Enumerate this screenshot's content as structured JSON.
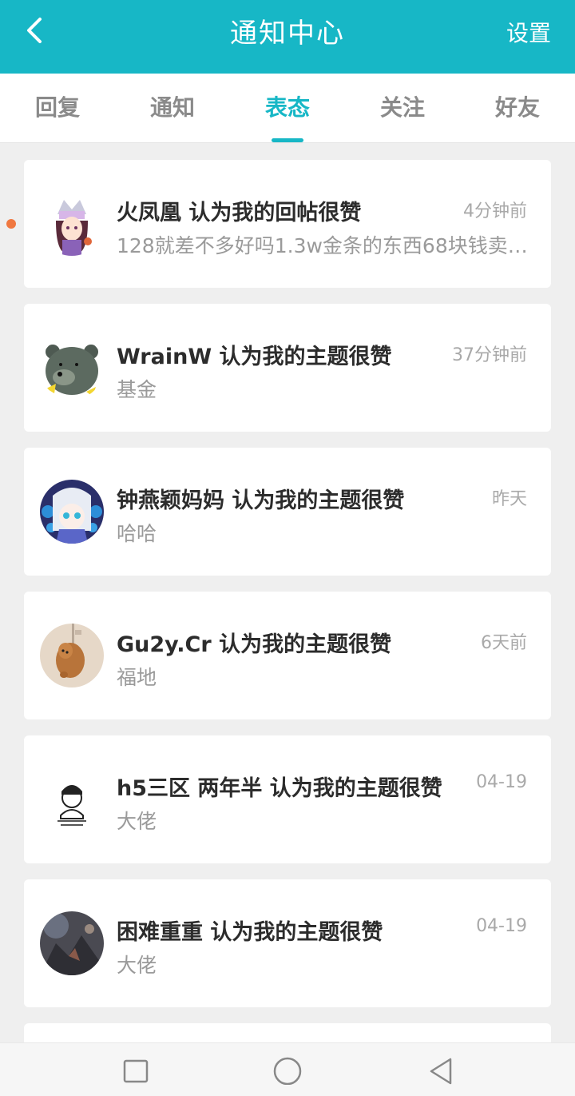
{
  "header": {
    "title": "通知中心",
    "settings_label": "设置",
    "back_icon": "chevron-left-icon",
    "color": "#17b7c6"
  },
  "tabs": [
    {
      "label": "回复",
      "active": false
    },
    {
      "label": "通知",
      "active": false
    },
    {
      "label": "表态",
      "active": true
    },
    {
      "label": "关注",
      "active": false
    },
    {
      "label": "好友",
      "active": false
    }
  ],
  "notifications": [
    {
      "title": "火凤凰 认为我的回帖很赞",
      "time": "4分钟前",
      "content": "128就差不多好吗1.3w金条的东西68块钱卖…",
      "avatar": "anime-girl-avatar",
      "unread": true
    },
    {
      "title": "WrainW 认为我的主题很赞",
      "time": "37分钟前",
      "content": "基金",
      "avatar": "bear-avatar",
      "unread": false
    },
    {
      "title": "钟燕颖妈妈 认为我的主题很赞",
      "time": "昨天",
      "content": "哈哈",
      "avatar": "anime-white-hair-avatar",
      "unread": false
    },
    {
      "title": "Gu2y.Cr 认为我的主题很赞",
      "time": "6天前",
      "content": "福地",
      "avatar": "dog-avatar",
      "unread": false
    },
    {
      "title": "h5三区  两年半 认为我的主题很赞",
      "time": "04-19",
      "content": "大佬",
      "avatar": "cartoon-person-avatar",
      "unread": false
    },
    {
      "title": "困难重重 认为我的主题很赞",
      "time": "04-19",
      "content": "大佬",
      "avatar": "dark-art-avatar",
      "unread": false
    }
  ],
  "navbar": {
    "recent_icon": "square-icon",
    "home_icon": "circle-icon",
    "back_icon": "triangle-back-icon"
  }
}
